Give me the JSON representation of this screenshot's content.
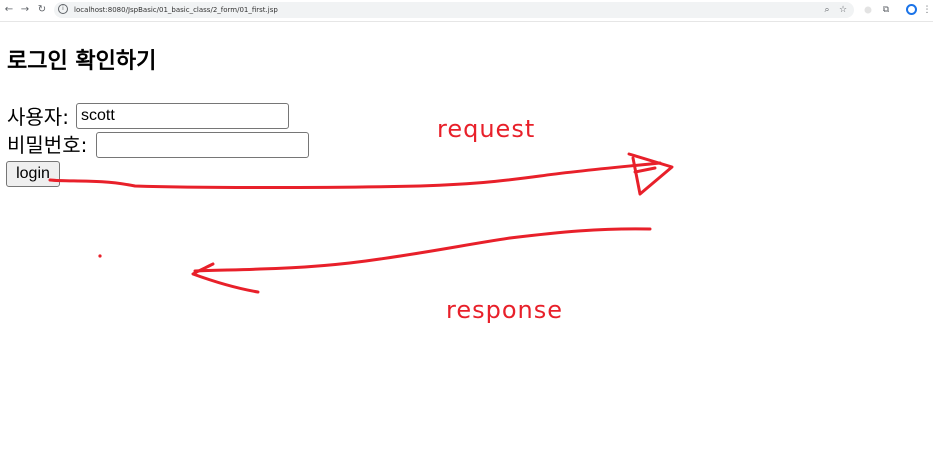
{
  "browser": {
    "back_icon": "←",
    "forward_icon": "→",
    "reload_icon": "↻",
    "site_info_icon": "i",
    "url": "localhost:8080/JspBasic/01_basic_class/2_form/01_first.jsp",
    "zoom_icon": "⌕",
    "star_icon": "☆",
    "extensions_icon": "⧉",
    "menu_icon": "⋮",
    "icon_color": "#5f6368",
    "profile_color": "#1a73e8"
  },
  "form": {
    "title": "로그인 확인하기",
    "user_label": "사용자:",
    "user_value": "scott",
    "password_label": "비밀번호:",
    "password_value": "",
    "login_label": "login"
  },
  "annotations": {
    "request": "request",
    "response": "response",
    "ink_color": "#e8202a"
  }
}
